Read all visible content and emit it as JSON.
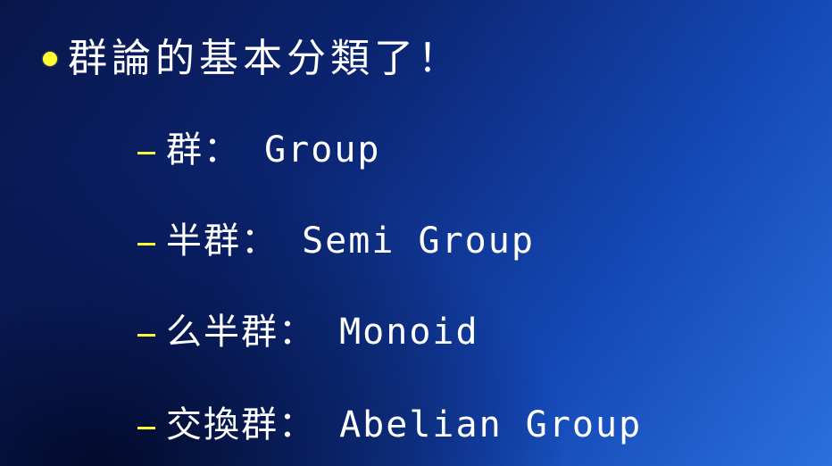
{
  "slide": {
    "title": "群論的基本分類了！",
    "bullet_color": "#ffff33",
    "items": [
      {
        "text": "群： Group"
      },
      {
        "text": "半群： Semi Group"
      },
      {
        "text": "么半群： Monoid"
      },
      {
        "text": "交換群： Abelian Group"
      }
    ]
  }
}
